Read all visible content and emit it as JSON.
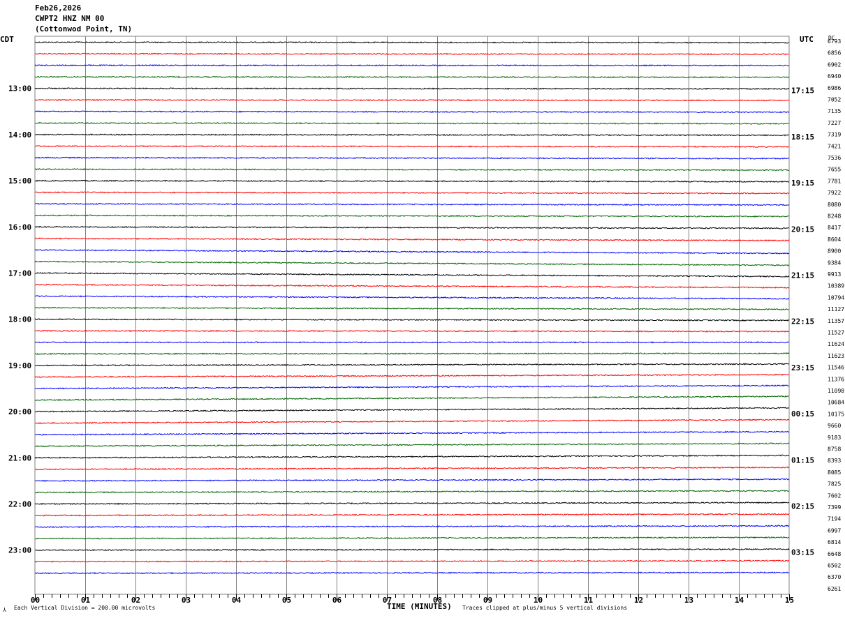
{
  "header": {
    "date": "Feb26,2026",
    "station": "CWPT2 HNZ NM 00",
    "location": "(Cottonwod Point, TN)"
  },
  "left_axis_label": "CDT",
  "right_axis_label": "UTC",
  "dc_label": "DC",
  "footer": {
    "scale": "Each Vertical Division =  200.00 microvolts",
    "xlabel": "TIME (MINUTES)",
    "clip_note": "Traces clipped at plus/minus 5 vertical divisions"
  },
  "colors": {
    "black": "#000000",
    "red": "#ff0000",
    "blue": "#0000ff",
    "green": "#006400",
    "grid": "#808080"
  },
  "chart_data": {
    "type": "line",
    "title": "",
    "xlabel": "TIME (MINUTES)",
    "xlim": [
      0,
      15
    ],
    "x_ticks": [
      "00",
      "01",
      "02",
      "03",
      "04",
      "05",
      "06",
      "07",
      "08",
      "09",
      "10",
      "11",
      "12",
      "13",
      "14",
      "15"
    ],
    "row_minutes": 15,
    "rows": 47,
    "series_colors": [
      "#000000",
      "#ff0000",
      "#0000ff",
      "#006400"
    ],
    "left_ticks": [
      {
        "row": 4,
        "label": "13:00"
      },
      {
        "row": 8,
        "label": "14:00"
      },
      {
        "row": 12,
        "label": "15:00"
      },
      {
        "row": 16,
        "label": "16:00"
      },
      {
        "row": 20,
        "label": "17:00"
      },
      {
        "row": 24,
        "label": "18:00"
      },
      {
        "row": 28,
        "label": "19:00"
      },
      {
        "row": 32,
        "label": "20:00"
      },
      {
        "row": 36,
        "label": "21:00"
      },
      {
        "row": 40,
        "label": "22:00"
      },
      {
        "row": 44,
        "label": "23:00"
      }
    ],
    "right_ticks": [
      {
        "row": 4,
        "label": "17:15"
      },
      {
        "row": 8,
        "label": "18:15"
      },
      {
        "row": 12,
        "label": "19:15"
      },
      {
        "row": 16,
        "label": "20:15"
      },
      {
        "row": 20,
        "label": "21:15"
      },
      {
        "row": 24,
        "label": "22:15"
      },
      {
        "row": 28,
        "label": "23:15"
      },
      {
        "row": 32,
        "label": "00:15"
      },
      {
        "row": 36,
        "label": "01:15"
      },
      {
        "row": 40,
        "label": "02:15"
      },
      {
        "row": 44,
        "label": "03:15"
      }
    ],
    "dc_values": [
      "6793",
      "6856",
      "6902",
      "6940",
      "6986",
      "7052",
      "7135",
      "7227",
      "7319",
      "7421",
      "7536",
      "7655",
      "7781",
      "7922",
      "8080",
      "8248",
      "8417",
      "8604",
      "8900",
      "9384",
      "9913",
      "10389",
      "10794",
      "11127",
      "11357",
      "11527",
      "11624",
      "11623",
      "11546",
      "11376",
      "11098",
      "10684",
      "10175",
      "9660",
      "9183",
      "8758",
      "8393",
      "8085",
      "7825",
      "7602",
      "7399",
      "7194",
      "6997",
      "6814",
      "6648",
      "6502",
      "6370",
      "6261"
    ],
    "trend_divisions": [
      -0.2,
      -0.2,
      -0.1,
      -0.2,
      -0.2,
      -0.2,
      -0.3,
      -0.3,
      -0.3,
      -0.3,
      -0.4,
      -0.4,
      -0.4,
      -0.5,
      -0.5,
      -0.5,
      -0.6,
      -0.9,
      -1.5,
      -1.6,
      -1.5,
      -1.3,
      -1.1,
      -0.7,
      -0.5,
      -0.3,
      0.0,
      0.2,
      0.6,
      1.0,
      1.3,
      1.6,
      1.6,
      1.5,
      1.3,
      1.2,
      1.0,
      0.8,
      0.7,
      0.7,
      0.6,
      0.6,
      0.5,
      0.5,
      0.4,
      0.4,
      0.3
    ]
  }
}
